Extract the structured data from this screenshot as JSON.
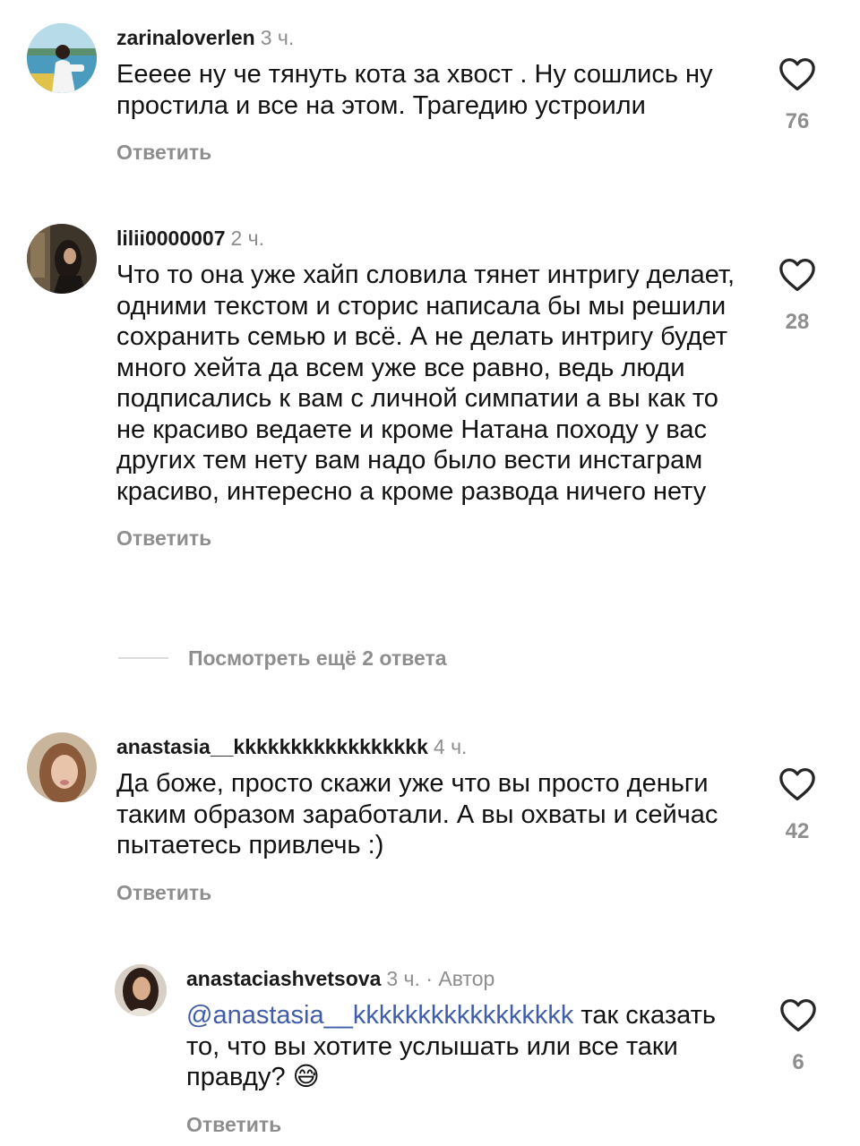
{
  "comments": [
    {
      "username": "zarinaloverlen",
      "time": "3 ч.",
      "text": "Ееееe ну че тянуть кота за хвост . Ну сошлись ну простила и все на этом. Трагедию устроили",
      "reply_label": "Ответить",
      "likes": "76"
    },
    {
      "username": "lilii0000007",
      "time": "2 ч.",
      "text": "Что то она уже хайп словила тянет интригу делает, одними текстом и сторис написала бы мы решили сохранить семью и всё. А не делать интригу будет много хейта да всем уже все равно, ведь люди подписались к вам с личной симпатии а вы как то не красиво ведаете и кроме Натана походу у вас других тем нету вам надо было вести инстаграм красиво, интересно а кроме развода ничего нету",
      "reply_label": "Ответить",
      "likes": "28",
      "view_more": "Посмотреть ещё 2 ответа"
    },
    {
      "username": "anastasia__kkkkkkkkkkkkkkkkk",
      "time": "4 ч.",
      "text": "Да боже, просто скажи уже что вы просто деньги таким образом заработали. А вы охваты и сейчас пытаетесь привлечь :)",
      "reply_label": "Ответить",
      "likes": "42"
    }
  ],
  "reply": {
    "username": "anastaciashvetsova",
    "time": "3 ч.",
    "separator": "·",
    "author_label": "Автор",
    "mention": "@anastasia__kkkkkkkkkkkkkkkkk",
    "text": "так сказать то, что вы хотите услышать или все таки правду?",
    "emoji": "😅",
    "reply_label": "Ответить",
    "likes": "6"
  },
  "colors": {
    "mention": "#3f5da8",
    "muted": "#8e8e8e"
  }
}
